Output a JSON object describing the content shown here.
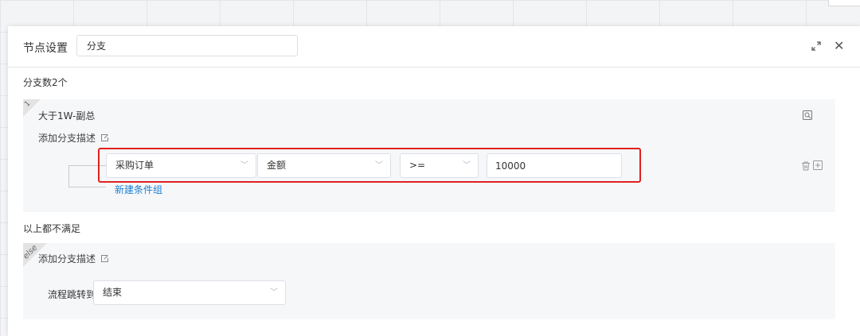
{
  "dialog": {
    "title": "节点设置",
    "node_name": "分支",
    "branch_count_text": "分支数2个",
    "expand_icon": "expand-icon",
    "close_icon": "close-icon"
  },
  "branches": [
    {
      "index_tag": "1",
      "title": "大于1W-副总",
      "add_desc_label": "添加分支描述",
      "condition": {
        "source": "采购订单",
        "field": "金额",
        "operator": ">=",
        "value": "10000"
      },
      "new_group_label": "新建条件组"
    }
  ],
  "else_branch": {
    "section_label": "以上都不满足",
    "tag": "else",
    "add_desc_label": "添加分支描述",
    "jump_label": "流程跳转到",
    "jump_target": "结束"
  },
  "colors": {
    "link": "#1b7fd3",
    "highlight": "#e02020",
    "card_bg": "#f6f7f9"
  }
}
